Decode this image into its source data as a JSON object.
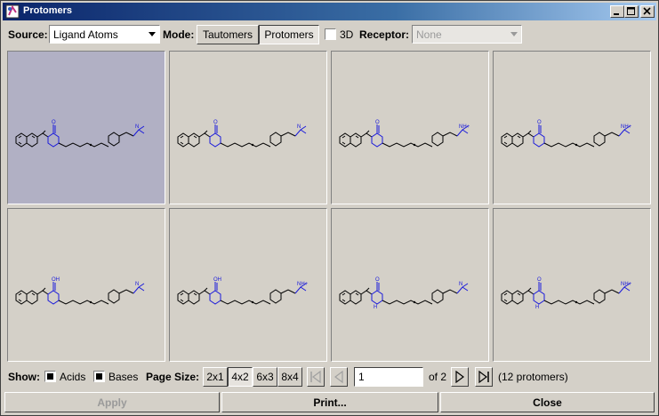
{
  "window": {
    "title": "Protomers"
  },
  "toolbar": {
    "source_label": "Source:",
    "source_value": "Ligand Atoms",
    "mode_label": "Mode:",
    "mode_options": [
      "Tautomers",
      "Protomers"
    ],
    "mode_selected": "Protomers",
    "threed_label": "3D",
    "receptor_label": "Receptor:",
    "receptor_value": "None"
  },
  "grid": {
    "cells": [
      {
        "selected": true,
        "substituent": "O",
        "ring_h": "",
        "amine_h": "N"
      },
      {
        "selected": false,
        "substituent": "O",
        "ring_h": "",
        "amine_h": "N"
      },
      {
        "selected": false,
        "substituent": "O",
        "ring_h": "",
        "amine_h": "NH+"
      },
      {
        "selected": false,
        "substituent": "O",
        "ring_h": "",
        "amine_h": "NH+"
      },
      {
        "selected": false,
        "substituent": "OH",
        "ring_h": "",
        "amine_h": "N"
      },
      {
        "selected": false,
        "substituent": "OH",
        "ring_h": "",
        "amine_h": "NH+"
      },
      {
        "selected": false,
        "substituent": "O",
        "ring_h": "H",
        "amine_h": "N"
      },
      {
        "selected": false,
        "substituent": "O",
        "ring_h": "H",
        "amine_h": "NH+"
      }
    ]
  },
  "footer": {
    "show_label": "Show:",
    "acids_label": "Acids",
    "bases_label": "Bases",
    "page_size_label": "Page Size:",
    "page_sizes": [
      "2x1",
      "4x2",
      "6x3",
      "8x4"
    ],
    "page_size_selected": "4x2",
    "current_page": "1",
    "of_pages": "of 2",
    "count_text": "(12 protomers)"
  },
  "actions": {
    "apply": "Apply",
    "print": "Print...",
    "close": "Close"
  },
  "colors": {
    "selected_cell": "#b1b0c4",
    "core_highlight": "#1a1adb",
    "titlebar": "#0a246a"
  }
}
